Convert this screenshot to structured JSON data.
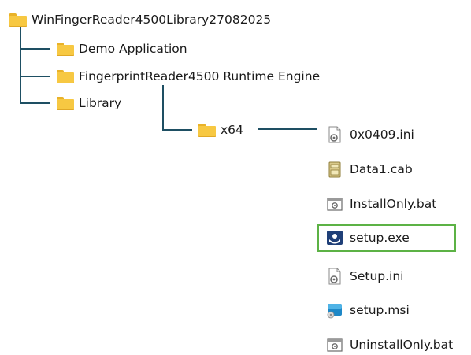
{
  "tree": {
    "root": {
      "label": "WinFingerReader4500Library27082025",
      "icon": "folder-icon"
    },
    "children": [
      {
        "label": "Demo Application",
        "icon": "folder-icon"
      },
      {
        "label": "FingerprintReader4500 Runtime Engine",
        "icon": "folder-icon"
      },
      {
        "label": "Library",
        "icon": "folder-icon"
      }
    ],
    "subfolder": {
      "label": "x64",
      "icon": "folder-icon"
    },
    "files": [
      {
        "label": "0x0409.ini",
        "icon": "ini-settings-icon"
      },
      {
        "label": "Data1.cab",
        "icon": "cabinet-archive-icon"
      },
      {
        "label": "InstallOnly.bat",
        "icon": "batch-file-icon"
      },
      {
        "label": "setup.exe",
        "icon": "setup-exe-icon",
        "highlighted": true
      },
      {
        "label": "Setup.ini",
        "icon": "ini-settings-icon"
      },
      {
        "label": "setup.msi",
        "icon": "msi-installer-icon"
      },
      {
        "label": "UninstallOnly.bat",
        "icon": "batch-file-icon"
      }
    ]
  },
  "colors": {
    "connector": "#1e4f63",
    "highlight_border": "#5cb245",
    "folder": "#f7c842"
  }
}
